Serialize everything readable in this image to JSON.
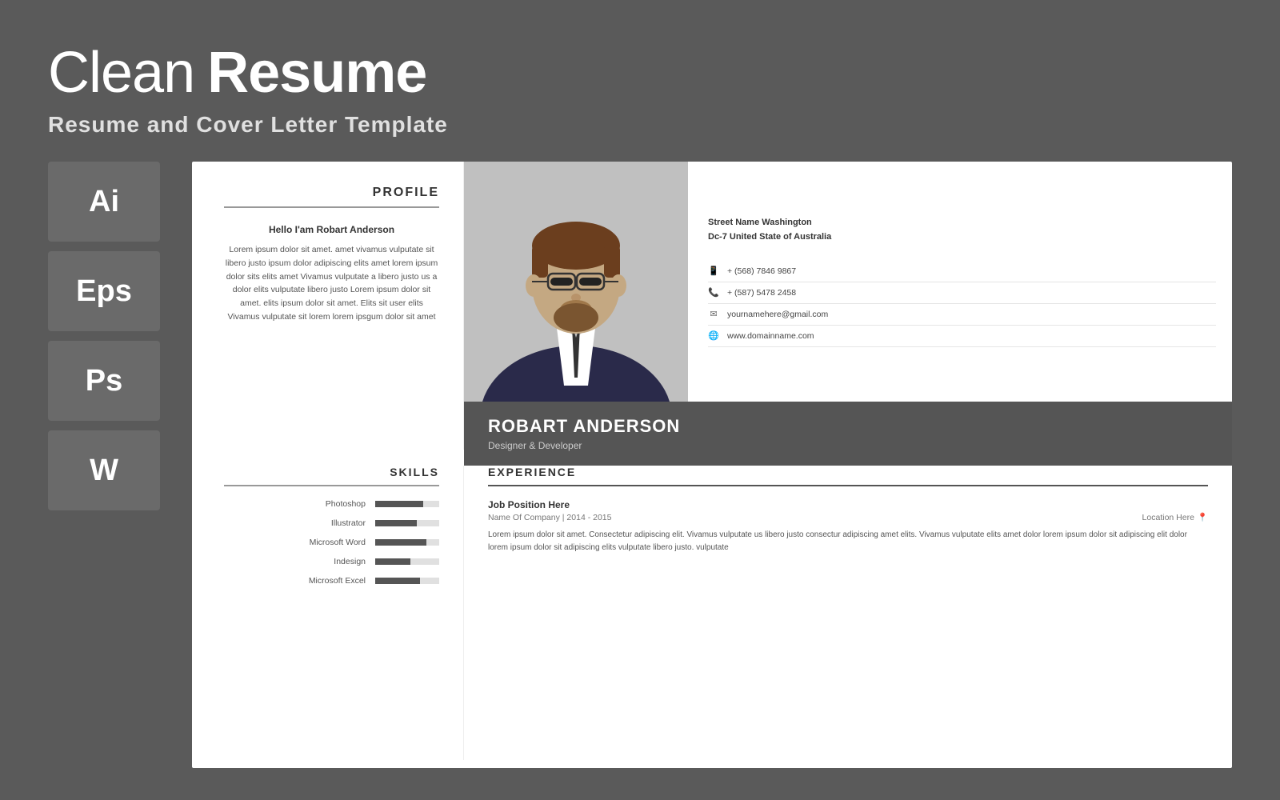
{
  "header": {
    "title_light": "Clean",
    "title_bold": "Resume",
    "subtitle": "Resume and Cover Letter Template"
  },
  "format_badges": [
    {
      "label": "Ai"
    },
    {
      "label": "Eps"
    },
    {
      "label": "Ps"
    },
    {
      "label": "W"
    }
  ],
  "resume": {
    "profile": {
      "section_title": "PROFILE",
      "hello": "Hello I'am Robart Anderson",
      "description": "Lorem ipsum dolor sit amet. amet vivamus vulputate sit libero justo ipsum dolor adipiscing elits amet lorem ipsum dolor sits elits amet Vivamus vulputate a libero justo us a dolor elits vulputate libero justo Lorem ipsum dolor sit amet. elits ipsum dolor sit amet. Elits sit user elits Vivamus vulputate sit lorem lorem ipsgum dolor sit amet"
    },
    "contact": {
      "address_line1": "Street Name Washington",
      "address_line2": "Dc-7 United State of Australia",
      "phone1": "+ (568) 7846 9867",
      "phone2": "+ (587) 5478 2458",
      "email": "yournamehere@gmail.com",
      "website": "www.domainname.com"
    },
    "person": {
      "name": "ROBART ANDERSON",
      "title": "Designer & Developer"
    },
    "skills": {
      "section_title": "SKILLS",
      "items": [
        {
          "name": "Photoshop",
          "level": 75
        },
        {
          "name": "Illustrator",
          "level": 65
        },
        {
          "name": "Microsoft Word",
          "level": 80
        },
        {
          "name": "Indesign",
          "level": 55
        },
        {
          "name": "Microsoft Excel",
          "level": 70
        }
      ]
    },
    "experience": {
      "section_title": "EXPERIENCE",
      "jobs": [
        {
          "title": "Job Position Here",
          "company": "Name Of Company  |  2014 - 2015",
          "location": "Location Here",
          "description": "Lorem ipsum dolor sit amet. Consectetur adipiscing elit. Vivamus vulputate us libero justo consectur adipiscing amet elits. Vivamus vulputate elits amet dolor lorem ipsum dolor sit adipiscing elit dolor lorem ipsum dolor sit adipiscing elits vulputate libero justo. vulputate"
        }
      ]
    }
  }
}
